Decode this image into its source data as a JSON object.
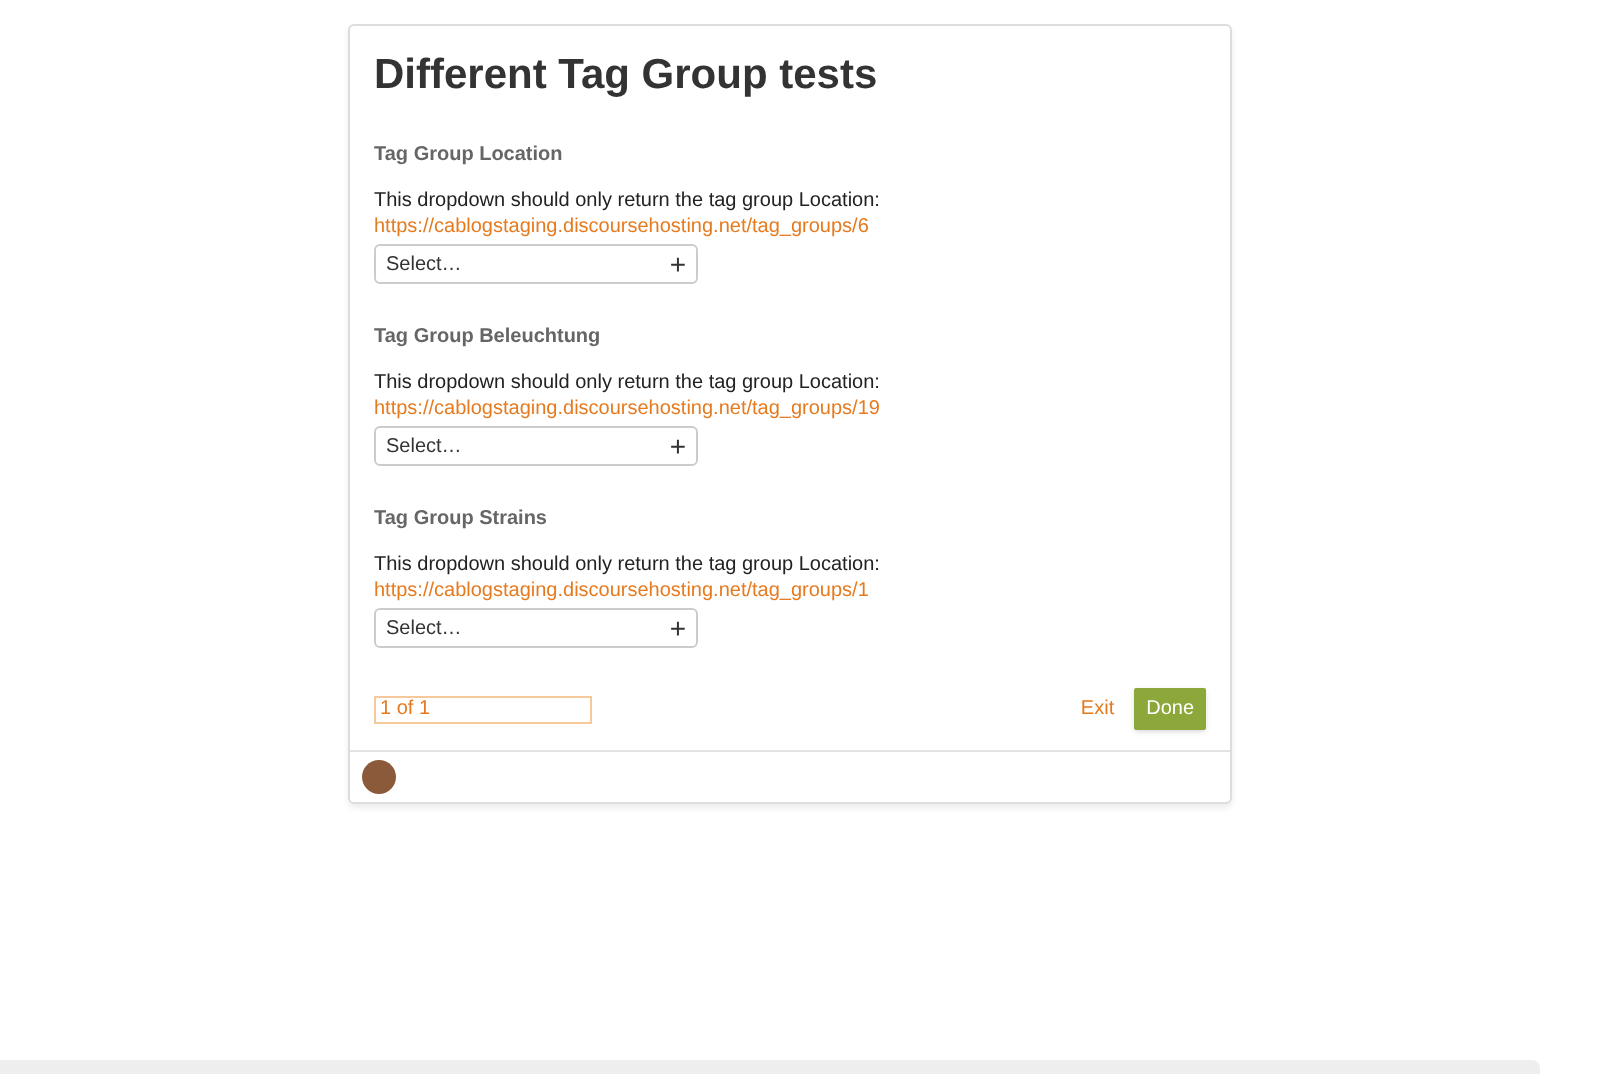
{
  "title": "Different Tag Group tests",
  "fields": [
    {
      "label": "Tag Group Location",
      "description": "This dropdown should only return the tag group Location:",
      "link": "https://cablogstaging.discoursehosting.net/tag_groups/6",
      "placeholder": "Select…",
      "button": "+"
    },
    {
      "label": "Tag Group Beleuchtung",
      "description": "This dropdown should only return the tag group Location:",
      "link": "https://cablogstaging.discoursehosting.net/tag_groups/19",
      "placeholder": "Select…",
      "button": "+"
    },
    {
      "label": "Tag Group Strains",
      "description": "This dropdown should only return the tag group Location:",
      "link": "https://cablogstaging.discoursehosting.net/tag_groups/1",
      "placeholder": "Select…",
      "button": "+"
    }
  ],
  "progress": "1 of 1",
  "buttons": {
    "exit": "Exit",
    "done": "Done"
  }
}
